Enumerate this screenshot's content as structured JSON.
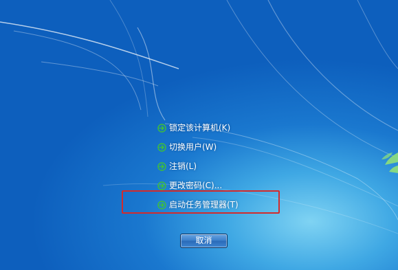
{
  "menu": {
    "items": [
      {
        "label": "锁定该计算机(K)"
      },
      {
        "label": "切换用户(W)"
      },
      {
        "label": "注销(L)"
      },
      {
        "label": "更改密码(C)..."
      },
      {
        "label": "启动任务管理器(T)"
      }
    ]
  },
  "cancel_button": {
    "label": "取消"
  },
  "icons": {
    "menu_item": "green-arrow-icon"
  },
  "colors": {
    "background": "#1a78cf",
    "arrow": "#3fbf3a",
    "highlight_border": "#d42a2a"
  }
}
